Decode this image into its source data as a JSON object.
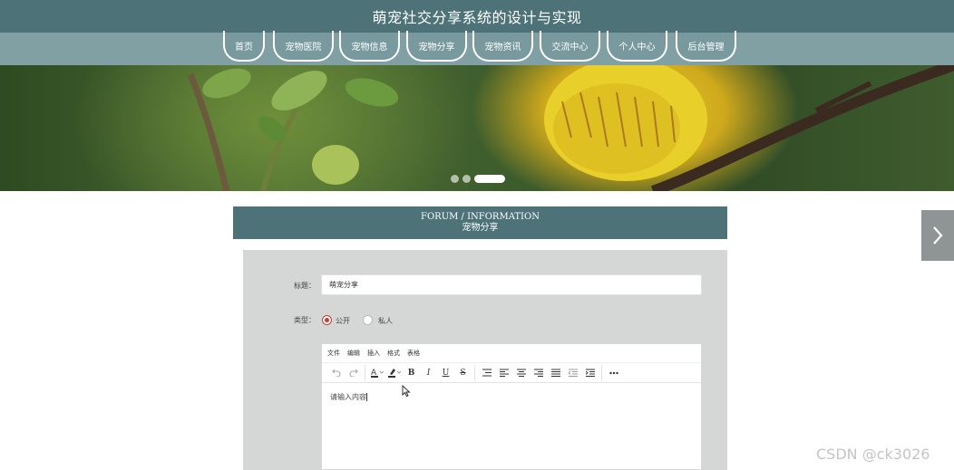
{
  "header": {
    "title": "萌宠社交分享系统的设计与实现"
  },
  "nav": {
    "items": [
      {
        "label": "首页"
      },
      {
        "label": "宠物医院"
      },
      {
        "label": "宠物信息"
      },
      {
        "label": "宠物分享"
      },
      {
        "label": "宠物资讯"
      },
      {
        "label": "交流中心"
      },
      {
        "label": "个人中心"
      },
      {
        "label": "后台管理"
      }
    ]
  },
  "carousel": {
    "slides": 3,
    "active_index": 2
  },
  "section": {
    "title_en": "FORUM / INFORMATION",
    "title_cn": "宠物分享"
  },
  "form": {
    "title_label": "标题：",
    "title_value": "萌宠分享",
    "type_label": "类型：",
    "type_options": [
      {
        "label": "公开",
        "checked": true
      },
      {
        "label": "私人",
        "checked": false
      }
    ],
    "editor": {
      "menu": [
        "文件",
        "编辑",
        "插入",
        "格式",
        "表格"
      ],
      "toolbar_icons": [
        "undo-icon",
        "redo-icon",
        "font-color-icon",
        "highlight-icon",
        "bold-icon",
        "italic-icon",
        "underline-icon",
        "strikethrough-icon",
        "line-height-icon",
        "align-left-icon",
        "align-center-icon",
        "align-right-icon",
        "align-justify-icon",
        "outdent-icon",
        "indent-icon",
        "more-icon"
      ],
      "content_placeholder": "请输入内容"
    }
  },
  "watermark": "CSDN @ck3026",
  "colors": {
    "primary": "#4d7378",
    "nav_bg": "#73969a",
    "panel_bg": "#d4d7d6",
    "radio_checked": "#d23b2b"
  }
}
